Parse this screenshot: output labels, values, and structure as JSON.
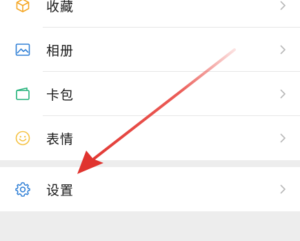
{
  "menu": {
    "items": [
      {
        "label": "收藏",
        "icon": "favorites-cube-icon"
      },
      {
        "label": "相册",
        "icon": "album-picture-icon"
      },
      {
        "label": "卡包",
        "icon": "card-wallet-icon"
      },
      {
        "label": "表情",
        "icon": "emoji-smiley-icon"
      }
    ],
    "settings": {
      "label": "设置",
      "icon": "settings-gear-icon"
    }
  },
  "colors": {
    "accent_blue": "#2f7fd6",
    "accent_green": "#23b27a",
    "accent_orange": "#f2a20c",
    "accent_amber": "#f5c242",
    "annotation_arrow": "#e8403a",
    "background_gray": "#ededed"
  }
}
